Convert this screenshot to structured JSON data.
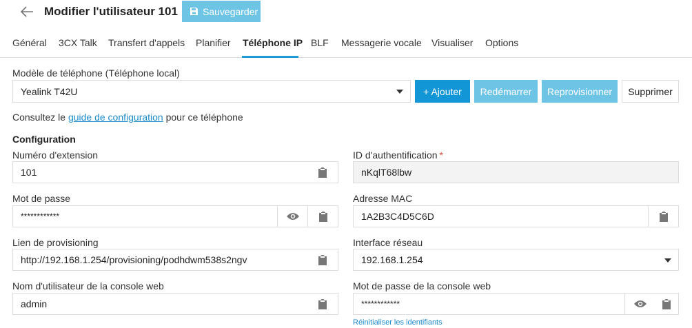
{
  "header": {
    "title": "Modifier l'utilisateur 101",
    "save_label": "Sauvegarder",
    "back_icon": "arrow-left-icon",
    "save_icon": "floppy-disk-icon"
  },
  "tabs": [
    {
      "label": "Général"
    },
    {
      "label": "3CX Talk"
    },
    {
      "label": "Transfert d'appels"
    },
    {
      "label": "Planifier"
    },
    {
      "label": "Téléphone IP",
      "active": true
    },
    {
      "label": "BLF"
    },
    {
      "label": "Messagerie vocale"
    },
    {
      "label": "Visualiser"
    },
    {
      "label": "Options"
    }
  ],
  "phone": {
    "model_label": "Modèle de téléphone (Téléphone local)",
    "model_value": "Yealink T42U",
    "add_label": "+ Ajouter",
    "restart_label": "Redémarrer",
    "reprovision_label": "Reprovisionner",
    "delete_label": "Supprimer"
  },
  "info": {
    "prefix": "Consultez le ",
    "link": "guide de configuration",
    "suffix": " pour ce téléphone"
  },
  "config": {
    "title": "Configuration",
    "extension_label": "Numéro d'extension",
    "extension_value": "101",
    "auth_label": "ID d'authentification",
    "auth_required": "*",
    "auth_value": "nKqlT68lbw",
    "password_label": "Mot de passe",
    "password_value": "************",
    "mac_label": "Adresse MAC",
    "mac_value": "1A2B3C4D5C6D",
    "prov_label": "Lien de provisioning",
    "prov_value": "http://192.168.1.254/provisioning/podhdwm538s2ngv",
    "iface_label": "Interface réseau",
    "iface_value": "192.168.1.254",
    "web_user_label": "Nom d'utilisateur de la console web",
    "web_user_value": "admin",
    "web_pass_label": "Mot de passe de la console web",
    "web_pass_value": "************",
    "reset_label": "Réinitialiser les identifiants"
  },
  "colors": {
    "primary": "#1296d5",
    "light_primary": "#6ec4e5",
    "link": "#1a8ccc",
    "tab_underline": "#1e9ad6",
    "required": "#e04a3a"
  }
}
